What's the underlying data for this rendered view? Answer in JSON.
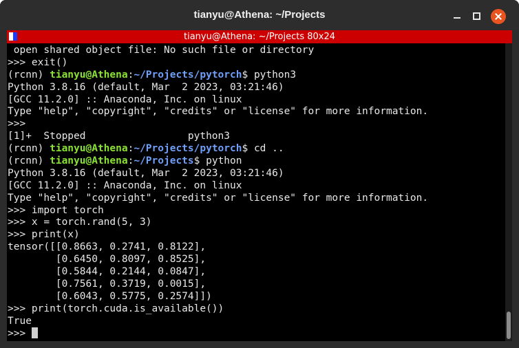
{
  "window": {
    "title": "tianyu@Athena: ~/Projects"
  },
  "xterm": {
    "title": "tianyu@Athena: ~/Projects 80x24"
  },
  "terminal": {
    "lines": [
      {
        "parts": [
          {
            "t": " open shared object file: No such file or directory",
            "c": ""
          }
        ]
      },
      {
        "parts": [
          {
            "t": ">>> exit()",
            "c": ""
          }
        ]
      },
      {
        "parts": [
          {
            "t": "(rcnn) ",
            "c": ""
          },
          {
            "t": "tianyu@Athena",
            "c": "u"
          },
          {
            "t": ":",
            "c": ""
          },
          {
            "t": "~/Projects/pytorch",
            "c": "p"
          },
          {
            "t": "$ python3",
            "c": ""
          }
        ]
      },
      {
        "parts": [
          {
            "t": "Python 3.8.16 (default, Mar  2 2023, 03:21:46)",
            "c": ""
          }
        ]
      },
      {
        "parts": [
          {
            "t": "[GCC 11.2.0] :: Anaconda, Inc. on linux",
            "c": ""
          }
        ]
      },
      {
        "parts": [
          {
            "t": "Type \"help\", \"copyright\", \"credits\" or \"license\" for more information.",
            "c": ""
          }
        ]
      },
      {
        "parts": [
          {
            "t": ">>>",
            "c": ""
          }
        ]
      },
      {
        "parts": [
          {
            "t": "[1]+  Stopped                 python3",
            "c": ""
          }
        ]
      },
      {
        "parts": [
          {
            "t": "(rcnn) ",
            "c": ""
          },
          {
            "t": "tianyu@Athena",
            "c": "u"
          },
          {
            "t": ":",
            "c": ""
          },
          {
            "t": "~/Projects/pytorch",
            "c": "p"
          },
          {
            "t": "$ cd ..",
            "c": ""
          }
        ]
      },
      {
        "parts": [
          {
            "t": "(rcnn) ",
            "c": ""
          },
          {
            "t": "tianyu@Athena",
            "c": "u"
          },
          {
            "t": ":",
            "c": ""
          },
          {
            "t": "~/Projects",
            "c": "p"
          },
          {
            "t": "$ python",
            "c": ""
          }
        ]
      },
      {
        "parts": [
          {
            "t": "Python 3.8.16 (default, Mar  2 2023, 03:21:46)",
            "c": ""
          }
        ]
      },
      {
        "parts": [
          {
            "t": "[GCC 11.2.0] :: Anaconda, Inc. on linux",
            "c": ""
          }
        ]
      },
      {
        "parts": [
          {
            "t": "Type \"help\", \"copyright\", \"credits\" or \"license\" for more information.",
            "c": ""
          }
        ]
      },
      {
        "parts": [
          {
            "t": ">>> import torch",
            "c": ""
          }
        ]
      },
      {
        "parts": [
          {
            "t": ">>> x = torch.rand(5, 3)",
            "c": ""
          }
        ]
      },
      {
        "parts": [
          {
            "t": ">>> print(x)",
            "c": ""
          }
        ]
      },
      {
        "parts": [
          {
            "t": "tensor([[0.8663, 0.2741, 0.8122],",
            "c": ""
          }
        ]
      },
      {
        "parts": [
          {
            "t": "        [0.6450, 0.8097, 0.8525],",
            "c": ""
          }
        ]
      },
      {
        "parts": [
          {
            "t": "        [0.5844, 0.2144, 0.0847],",
            "c": ""
          }
        ]
      },
      {
        "parts": [
          {
            "t": "        [0.7561, 0.3719, 0.0015],",
            "c": ""
          }
        ]
      },
      {
        "parts": [
          {
            "t": "        [0.6043, 0.5775, 0.2574]])",
            "c": ""
          }
        ]
      },
      {
        "parts": [
          {
            "t": ">>> print(torch.cuda.is_available())",
            "c": ""
          }
        ]
      },
      {
        "parts": [
          {
            "t": "True",
            "c": ""
          }
        ]
      },
      {
        "parts": [
          {
            "t": ">>> ",
            "c": ""
          }
        ],
        "cursor": true
      }
    ]
  },
  "colors": {
    "user_host": "#8ae234",
    "path": "#6f9ff8",
    "xterm_bar": "#cc0000",
    "close_button": "#e95420"
  },
  "icons": {
    "minimize": "minimize-icon",
    "maximize": "maximize-icon",
    "close": "close-icon",
    "xterm": "xterm-icon"
  }
}
